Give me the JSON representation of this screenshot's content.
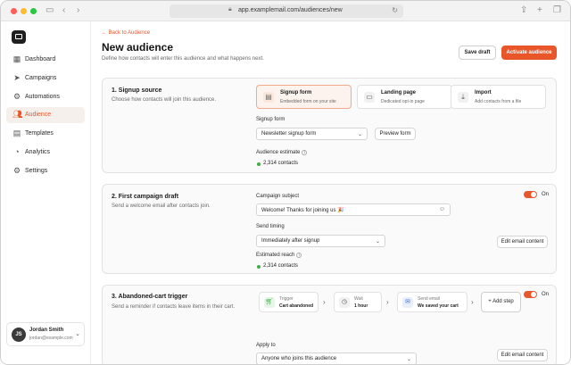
{
  "browser": {
    "url": "app.examplemail.com/audiences/new"
  },
  "sidebar": {
    "items": [
      {
        "label": "Dashboard",
        "icon": "grid-icon"
      },
      {
        "label": "Campaigns",
        "icon": "send-icon"
      },
      {
        "label": "Automations",
        "icon": "automation-icon"
      },
      {
        "label": "Audience",
        "icon": "users-icon"
      },
      {
        "label": "Templates",
        "icon": "template-icon"
      },
      {
        "label": "Analytics",
        "icon": "chart-icon"
      },
      {
        "label": "Settings",
        "icon": "gear-icon"
      }
    ],
    "active": "Audience",
    "user": {
      "initials": "JS",
      "name": "Jordan Smith",
      "email": "jordan@example.com"
    }
  },
  "header": {
    "back_label": "Back to Audience",
    "title": "New audience",
    "subtitle": "Define how contacts will enter this audience and what happens next.",
    "save_draft_label": "Save draft",
    "activate_label": "Activate audience"
  },
  "signup": {
    "title": "1. Signup source",
    "description": "Choose how contacts will join this audience.",
    "options": [
      {
        "title": "Signup form",
        "description": "Embedded form on your site",
        "selected": true
      },
      {
        "title": "Landing page",
        "description": "Dedicated opt-in page",
        "selected": false
      },
      {
        "title": "Import",
        "description": "Add contacts from a file",
        "selected": false
      }
    ],
    "form_label": "Signup form",
    "form_value": "Newsletter signup form",
    "preview_label": "Preview form",
    "estimate_label": "Audience estimate",
    "estimate_value": "2,314 contacts"
  },
  "campaign": {
    "title": "2. First campaign draft",
    "description": "Send a welcome email after contacts join.",
    "toggle_label": "On",
    "toggle_on": true,
    "subject_label": "Campaign subject",
    "subject_value": "Welcome! Thanks for joining us 🎉",
    "timing_label": "Send timing",
    "timing_value": "Immediately after signup",
    "edit_label": "Edit email content",
    "reach_label": "Estimated reach",
    "reach_value": "2,314 contacts"
  },
  "cart": {
    "title": "3. Abandoned-cart trigger",
    "description": "Send a reminder if contacts leave items in their cart.",
    "toggle_label": "On",
    "toggle_on": true,
    "steps": [
      {
        "kind": "Trigger",
        "value": "Cart abandoned"
      },
      {
        "kind": "Wait",
        "value": "1 hour"
      },
      {
        "kind": "Send email",
        "value": "We saved your cart"
      }
    ],
    "add_step_label": "+ Add step",
    "apply_label": "Apply to",
    "apply_value": "Anyone who joins this audience",
    "edit_label": "Edit email content"
  },
  "colors": {
    "accent": "#e8562a",
    "success": "#3cb043"
  }
}
